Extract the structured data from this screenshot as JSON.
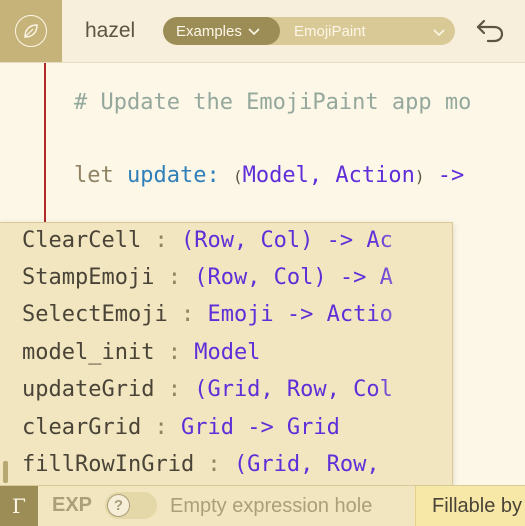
{
  "app": {
    "name": "hazel",
    "logo_icon": "hazel-leaf-icon"
  },
  "toolbar": {
    "examples_label": "Examples",
    "selected_example": "EmojiPaint",
    "undo_icon": "undo-icon"
  },
  "editor": {
    "comment": "# Update the EmojiPaint app mo",
    "decl": {
      "keyword": "let",
      "name": "update",
      "colon": ":",
      "paren_open": "(",
      "type": "Model, Action",
      "paren_close": ")",
      "arrow": " ->"
    }
  },
  "suggestions": [
    {
      "name": "ClearCell",
      "type": "(Row, Col) -> Ac"
    },
    {
      "name": "StampEmoji",
      "type": "(Row, Col) -> A"
    },
    {
      "name": "SelectEmoji",
      "type": "Emoji -> Actio"
    },
    {
      "name": "model_init",
      "type": "Model"
    },
    {
      "name": "updateGrid",
      "type": "(Grid, Row, Col"
    },
    {
      "name": "clearGrid",
      "type": "Grid -> Grid"
    },
    {
      "name": "fillRowInGrid",
      "type": "(Grid, Row,"
    }
  ],
  "status": {
    "gamma": "Γ",
    "mode": "EXP",
    "help": "?",
    "message": "Empty expression hole",
    "fillable": "Fillable by"
  },
  "colors": {
    "accent": "#9c8d57",
    "type": "#5f2ed9",
    "fn": "#2f7fb8",
    "gutter": "#b22a2a"
  }
}
